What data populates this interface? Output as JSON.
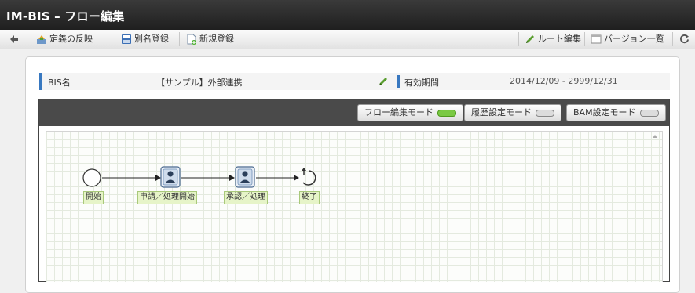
{
  "app": {
    "title": "IM-BIS – フロー編集"
  },
  "toolbar": {
    "back": "",
    "reflect": "定義の反映",
    "save_as": "別名登録",
    "new_register": "新規登録",
    "route_edit": "ルート編集",
    "version_list": "バージョン一覧",
    "refresh": ""
  },
  "info": {
    "bis_name_label": "BIS名",
    "bis_name_value": "【サンプル】外部連携",
    "period_label": "有効期間",
    "period_value": "2014/12/09 - 2999/12/31"
  },
  "modes": {
    "flow_edit": "フロー編集モード",
    "history_setting": "履歴設定モード",
    "bam_setting": "BAM設定モード",
    "active_color": "#7ac943",
    "inactive_color": "#dcdcdc"
  },
  "flow": {
    "nodes": [
      {
        "icon": "start-circle-icon",
        "label": "開始"
      },
      {
        "icon": "user-task-icon",
        "label": "申請／処理開始"
      },
      {
        "icon": "user-task-icon",
        "label": "承認／処理"
      },
      {
        "icon": "end-icon",
        "label": "終了"
      }
    ]
  }
}
